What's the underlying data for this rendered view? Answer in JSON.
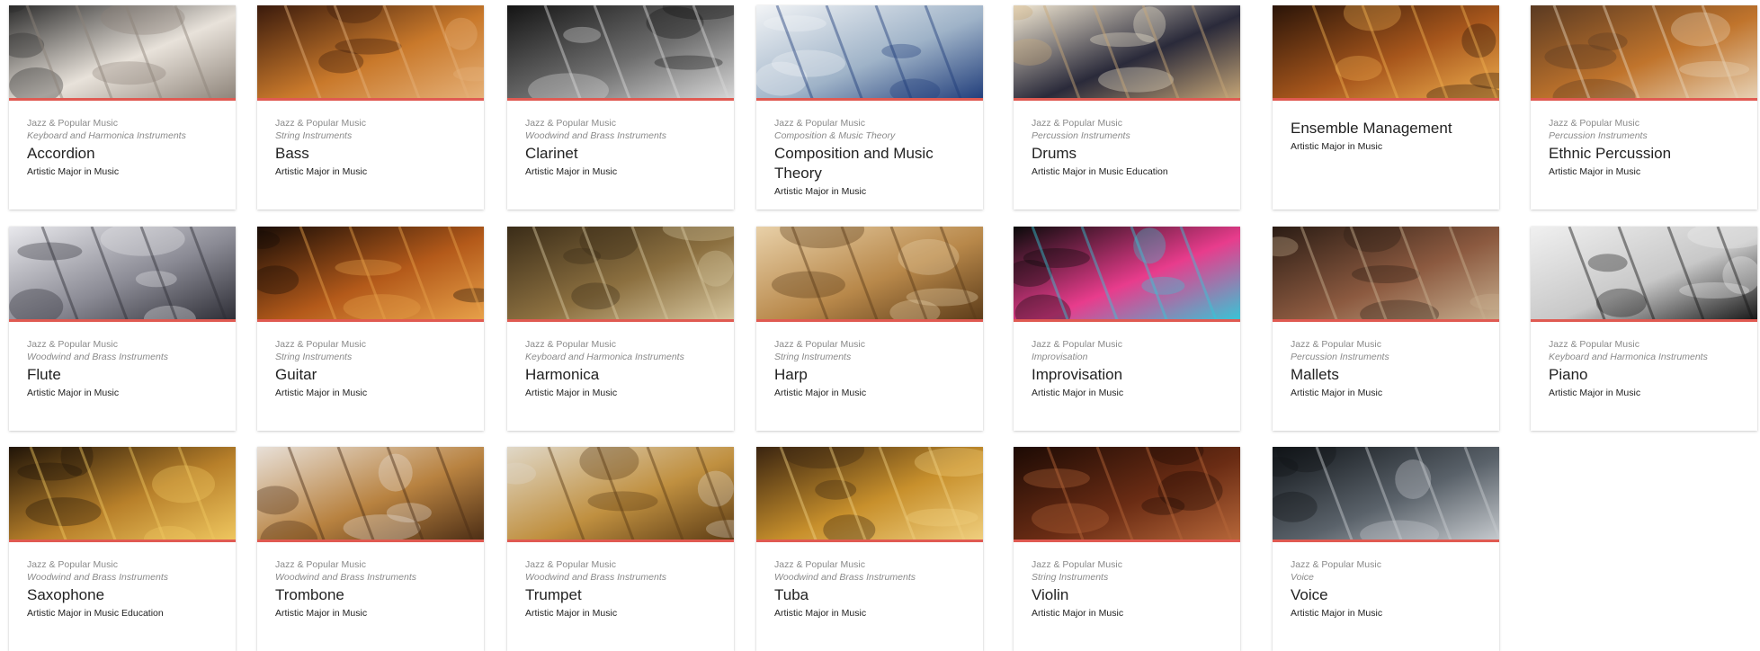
{
  "cards": [
    {
      "dept": "Jazz & Popular Music",
      "category": "Keyboard and Harmonica Instruments",
      "title": "Accordion",
      "major": "Artistic Major in Music",
      "image": "accordion-photo",
      "colors": [
        "#2b2b2b",
        "#e8e2da",
        "#8c8278"
      ]
    },
    {
      "dept": "Jazz & Popular Music",
      "category": "String Instruments",
      "title": "Bass",
      "major": "Artistic Major in Music",
      "image": "bass-guitar-photo",
      "colors": [
        "#3a1a0c",
        "#c9792b",
        "#e6b27a"
      ]
    },
    {
      "dept": "Jazz & Popular Music",
      "category": "Woodwind and Brass Instruments",
      "title": "Clarinet",
      "major": "Artistic Major in Music",
      "image": "clarinet-photo",
      "colors": [
        "#141414",
        "#6e6e6e",
        "#d9d9d9"
      ]
    },
    {
      "dept": "Jazz & Popular Music",
      "category": "Composition & Music Theory",
      "title": "Composition and Music Theory",
      "major": "Artistic Major in Music",
      "image": "sheet-music-photo",
      "colors": [
        "#f2f4f6",
        "#9fb3c8",
        "#1f3c7a"
      ]
    },
    {
      "dept": "Jazz & Popular Music",
      "category": "Percussion Instruments",
      "title": "Drums",
      "major": "Artistic Major in Music Education",
      "image": "drumsticks-photo",
      "colors": [
        "#f1e7d2",
        "#2a2a3a",
        "#c9a878"
      ]
    },
    {
      "dept": "",
      "category": "",
      "title": "Ensemble Management",
      "major": "Artistic Major in Music",
      "image": "ensemble-photo",
      "colors": [
        "#2a1408",
        "#a8571c",
        "#f0b050"
      ]
    },
    {
      "dept": "Jazz & Popular Music",
      "category": "Percussion Instruments",
      "title": "Ethnic Percussion",
      "major": "Artistic Major in Music",
      "image": "djembe-photo",
      "colors": [
        "#5a3a22",
        "#c0742c",
        "#e8d4b8"
      ]
    },
    {
      "dept": "Jazz & Popular Music",
      "category": "Woodwind and Brass Instruments",
      "title": "Flute",
      "major": "Artistic Major in Music",
      "image": "flute-photo",
      "colors": [
        "#e8e8ec",
        "#8a8a94",
        "#2c2c34"
      ]
    },
    {
      "dept": "Jazz & Popular Music",
      "category": "String Instruments",
      "title": "Guitar",
      "major": "Artistic Major in Music",
      "image": "guitar-photo",
      "colors": [
        "#180c06",
        "#b45a1a",
        "#e8a24a"
      ]
    },
    {
      "dept": "Jazz & Popular Music",
      "category": "Keyboard and Harmonica Instruments",
      "title": "Harmonica",
      "major": "Artistic Major in Music",
      "image": "harmonica-photo",
      "colors": [
        "#3a2c18",
        "#8c7040",
        "#d8c8a0"
      ]
    },
    {
      "dept": "Jazz & Popular Music",
      "category": "String Instruments",
      "title": "Harp",
      "major": "Artistic Major in Music",
      "image": "harp-photo",
      "colors": [
        "#e8d0a8",
        "#b8884a",
        "#5a3a18"
      ]
    },
    {
      "dept": "Jazz & Popular Music",
      "category": "Improvisation",
      "title": "Improvisation",
      "major": "Artistic Major in Music",
      "image": "color-explosion-photo",
      "colors": [
        "#0a0a0a",
        "#e83c8c",
        "#34c8d8"
      ]
    },
    {
      "dept": "Jazz & Popular Music",
      "category": "Percussion Instruments",
      "title": "Mallets",
      "major": "Artistic Major in Music",
      "image": "mallets-photo",
      "colors": [
        "#2a1c14",
        "#8c5a40",
        "#c8b090"
      ]
    },
    {
      "dept": "Jazz & Popular Music",
      "category": "Keyboard and Harmonica Instruments",
      "title": "Piano",
      "major": "Artistic Major in Music",
      "image": "piano-keys-photo",
      "colors": [
        "#f0f0f0",
        "#c8c8c8",
        "#141414"
      ]
    },
    {
      "dept": "Jazz & Popular Music",
      "category": "Woodwind and Brass Instruments",
      "title": "Saxophone",
      "major": "Artistic Major in Music Education",
      "image": "saxophone-photo",
      "colors": [
        "#201408",
        "#b8802a",
        "#f0c860"
      ]
    },
    {
      "dept": "Jazz & Popular Music",
      "category": "Woodwind and Brass Instruments",
      "title": "Trombone",
      "major": "Artistic Major in Music",
      "image": "trombone-photo",
      "colors": [
        "#e8e0d8",
        "#b88240",
        "#4a2c14"
      ]
    },
    {
      "dept": "Jazz & Popular Music",
      "category": "Woodwind and Brass Instruments",
      "title": "Trumpet",
      "major": "Artistic Major in Music",
      "image": "trumpet-photo",
      "colors": [
        "#e0d8c8",
        "#c09040",
        "#5a3a14"
      ]
    },
    {
      "dept": "Jazz & Popular Music",
      "category": "Woodwind and Brass Instruments",
      "title": "Tuba",
      "major": "Artistic Major in Music",
      "image": "tuba-photo",
      "colors": [
        "#3a2410",
        "#c8902c",
        "#f0d080"
      ]
    },
    {
      "dept": "Jazz & Popular Music",
      "category": "String Instruments",
      "title": "Violin",
      "major": "Artistic Major in Music",
      "image": "violin-photo",
      "colors": [
        "#1c0a04",
        "#6a2c14",
        "#b8683a"
      ]
    },
    {
      "dept": "Jazz & Popular Music",
      "category": "Voice",
      "title": "Voice",
      "major": "Artistic Major in Music",
      "image": "microphone-photo",
      "colors": [
        "#101418",
        "#5a626a",
        "#c8ccd0"
      ]
    }
  ],
  "accent_color": "#e05a52"
}
